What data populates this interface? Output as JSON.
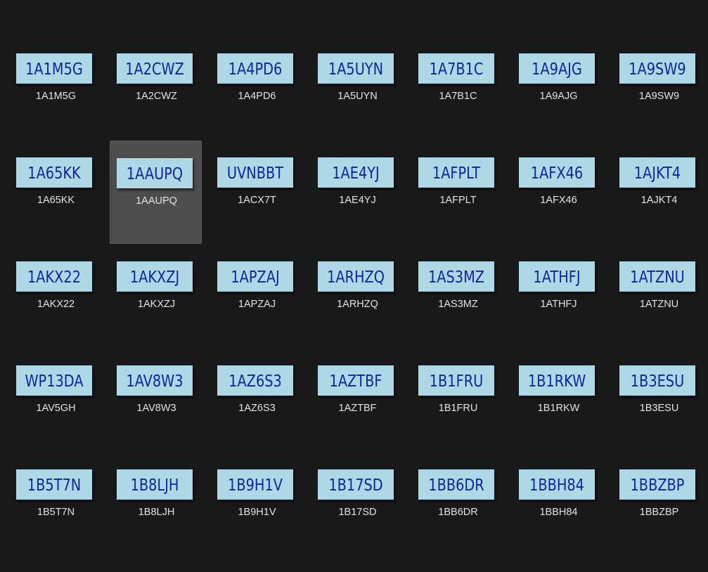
{
  "files": [
    {
      "handwriting": "1A1M5G",
      "filename": "1A1M5G",
      "selected": false
    },
    {
      "handwriting": "1A2CWZ",
      "filename": "1A2CWZ",
      "selected": false
    },
    {
      "handwriting": "1A4PD6",
      "filename": "1A4PD6",
      "selected": false
    },
    {
      "handwriting": "1A5UYN",
      "filename": "1A5UYN",
      "selected": false
    },
    {
      "handwriting": "1A7B1C",
      "filename": "1A7B1C",
      "selected": false
    },
    {
      "handwriting": "1A9AJG",
      "filename": "1A9AJG",
      "selected": false
    },
    {
      "handwriting": "1A9SW9",
      "filename": "1A9SW9",
      "selected": false
    },
    {
      "handwriting": "1A65KK",
      "filename": "1A65KK",
      "selected": false
    },
    {
      "handwriting": "1AAUPQ",
      "filename": "1AAUPQ",
      "selected": true
    },
    {
      "handwriting": "UVNBBT",
      "filename": "1ACX7T",
      "selected": false
    },
    {
      "handwriting": "1AE4YJ",
      "filename": "1AE4YJ",
      "selected": false
    },
    {
      "handwriting": "1AFPLT",
      "filename": "1AFPLT",
      "selected": false
    },
    {
      "handwriting": "1AFX46",
      "filename": "1AFX46",
      "selected": false
    },
    {
      "handwriting": "1AJKT4",
      "filename": "1AJKT4",
      "selected": false
    },
    {
      "handwriting": "1AKX22",
      "filename": "1AKX22",
      "selected": false
    },
    {
      "handwriting": "1AKXZJ",
      "filename": "1AKXZJ",
      "selected": false
    },
    {
      "handwriting": "1APZAJ",
      "filename": "1APZAJ",
      "selected": false
    },
    {
      "handwriting": "1ARHZQ",
      "filename": "1ARHZQ",
      "selected": false
    },
    {
      "handwriting": "1AS3MZ",
      "filename": "1AS3MZ",
      "selected": false
    },
    {
      "handwriting": "1ATHFJ",
      "filename": "1ATHFJ",
      "selected": false
    },
    {
      "handwriting": "1ATZNU",
      "filename": "1ATZNU",
      "selected": false
    },
    {
      "handwriting": "WP13DA",
      "filename": "1AV5GH",
      "selected": false
    },
    {
      "handwriting": "1AV8W3",
      "filename": "1AV8W3",
      "selected": false
    },
    {
      "handwriting": "1AZ6S3",
      "filename": "1AZ6S3",
      "selected": false
    },
    {
      "handwriting": "1AZTBF",
      "filename": "1AZTBF",
      "selected": false
    },
    {
      "handwriting": "1B1FRU",
      "filename": "1B1FRU",
      "selected": false
    },
    {
      "handwriting": "1B1RKW",
      "filename": "1B1RKW",
      "selected": false
    },
    {
      "handwriting": "1B3ESU",
      "filename": "1B3ESU",
      "selected": false
    },
    {
      "handwriting": "1B5T7N",
      "filename": "1B5T7N",
      "selected": false
    },
    {
      "handwriting": "1B8LJH",
      "filename": "1B8LJH",
      "selected": false
    },
    {
      "handwriting": "1B9H1V",
      "filename": "1B9H1V",
      "selected": false
    },
    {
      "handwriting": "1B17SD",
      "filename": "1B17SD",
      "selected": false
    },
    {
      "handwriting": "1BB6DR",
      "filename": "1BB6DR",
      "selected": false
    },
    {
      "handwriting": "1BBH84",
      "filename": "1BBH84",
      "selected": false
    },
    {
      "handwriting": "1BBZBP",
      "filename": "1BBZBP",
      "selected": false
    }
  ]
}
